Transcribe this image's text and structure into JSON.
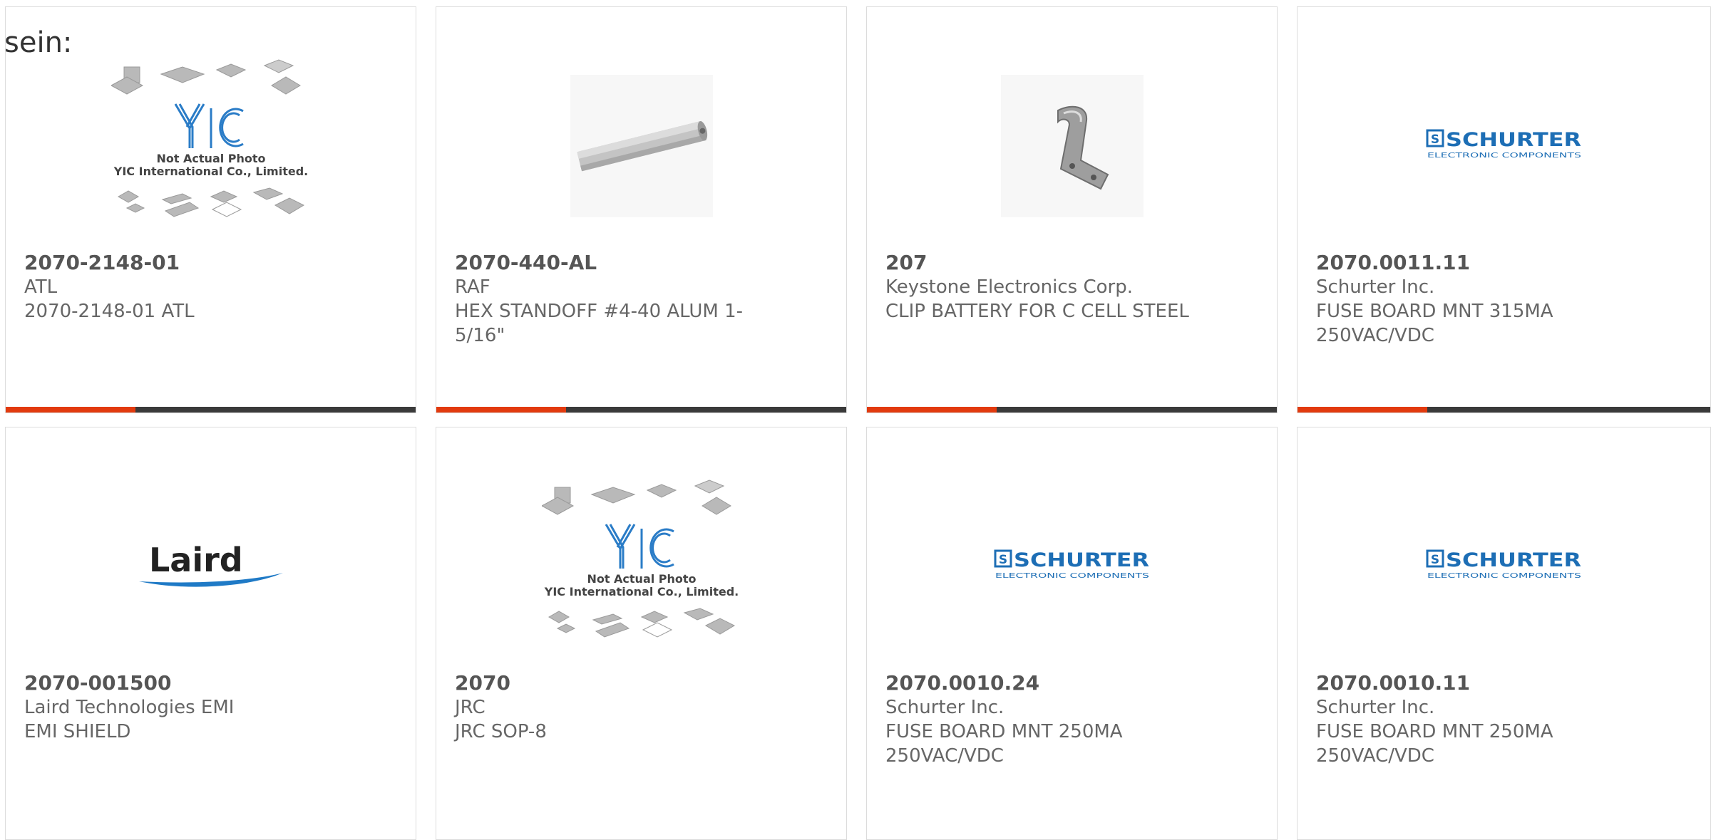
{
  "prefix_text": "sein:",
  "colors": {
    "accent": "#e23a0e",
    "bar": "#3a3a3a",
    "schurter_blue": "#1d6eb5",
    "laird_blue": "#1f7ac6"
  },
  "placeholder": {
    "line1": "Not Actual Photo",
    "line2": "YIC International Co., Limited.",
    "logo_text": "YIC"
  },
  "schurter_logo": {
    "brand": "SCHURTER",
    "badge": "S",
    "sub": "ELECTRONIC COMPONENTS"
  },
  "laird_logo": {
    "brand": "Laird"
  },
  "products": [
    {
      "part": "2070-2148-01",
      "maker": "ATL",
      "desc": "2070-2148-01 ATL",
      "image": "placeholder-icon"
    },
    {
      "part": "2070-440-AL",
      "maker": "RAF",
      "desc": "HEX STANDOFF #4-40 ALUM 1-5/16\"",
      "image": "standoff-photo"
    },
    {
      "part": "207",
      "maker": "Keystone Electronics Corp.",
      "desc": "CLIP BATTERY FOR C CELL STEEL",
      "image": "clip-photo"
    },
    {
      "part": "2070.0011.11",
      "maker": "Schurter Inc.",
      "desc": "FUSE BOARD MNT 315MA 250VAC/VDC",
      "image": "schurter-logo"
    },
    {
      "part": "2070-001500",
      "maker": "Laird Technologies EMI",
      "desc": "EMI SHIELD",
      "image": "laird-logo"
    },
    {
      "part": "2070",
      "maker": "JRC",
      "desc": "JRC SOP-8",
      "image": "placeholder-icon"
    },
    {
      "part": "2070.0010.24",
      "maker": "Schurter Inc.",
      "desc": "FUSE BOARD MNT 250MA 250VAC/VDC",
      "image": "schurter-logo"
    },
    {
      "part": "2070.0010.11",
      "maker": "Schurter Inc.",
      "desc": "FUSE BOARD MNT 250MA 250VAC/VDC",
      "image": "schurter-logo"
    }
  ]
}
